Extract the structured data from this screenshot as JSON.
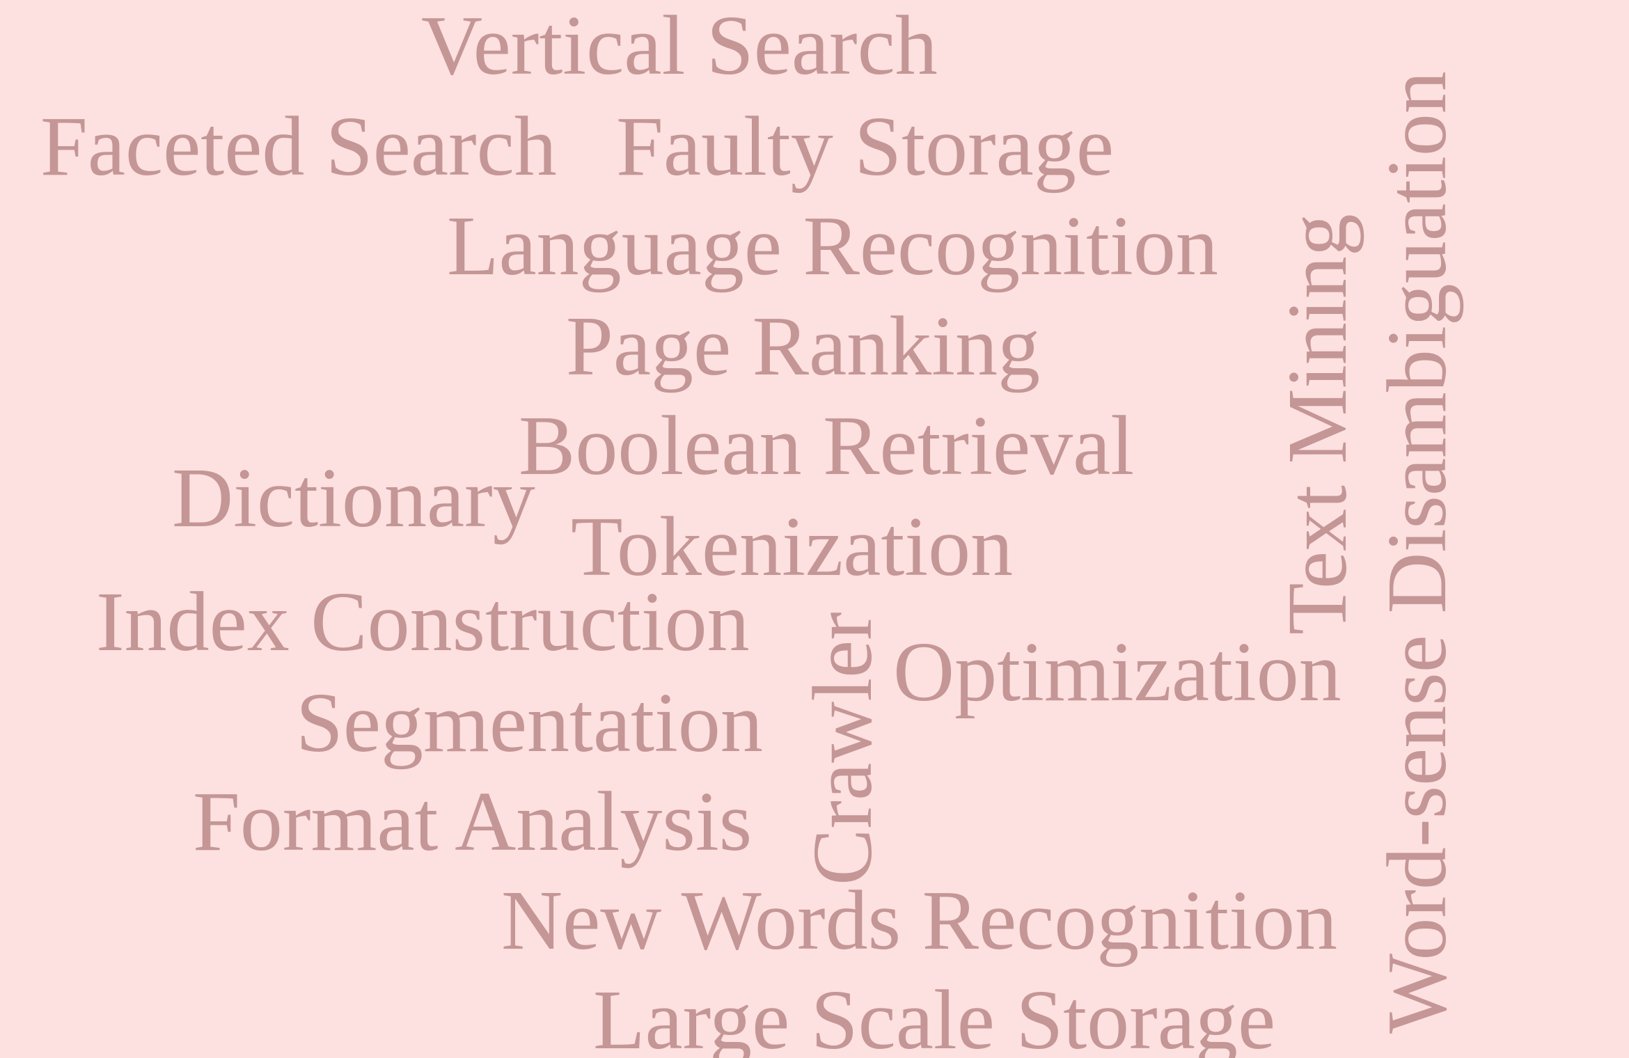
{
  "background_color": "#fde0e0",
  "word_color": "#c49696",
  "words": {
    "vertical_search": "Vertical Search",
    "faceted_search": "Faceted Search",
    "faulty_storage": "Faulty Storage",
    "language_recognition": "Language Recognition",
    "page_ranking": "Page Ranking",
    "boolean_retrieval": "Boolean Retrieval",
    "dictionary": "Dictionary",
    "tokenization": "Tokenization",
    "index_construction": "Index Construction",
    "crawler": "Crawler",
    "optimization": "Optimization",
    "segmentation": "Segmentation",
    "format_analysis": "Format Analysis",
    "new_words_recognition": "New Words Recognition",
    "large_scale_storage": "Large Scale Storage",
    "text_mining": "Text Mining",
    "word_sense_disambiguation": "Word-sense Disambiguation"
  }
}
